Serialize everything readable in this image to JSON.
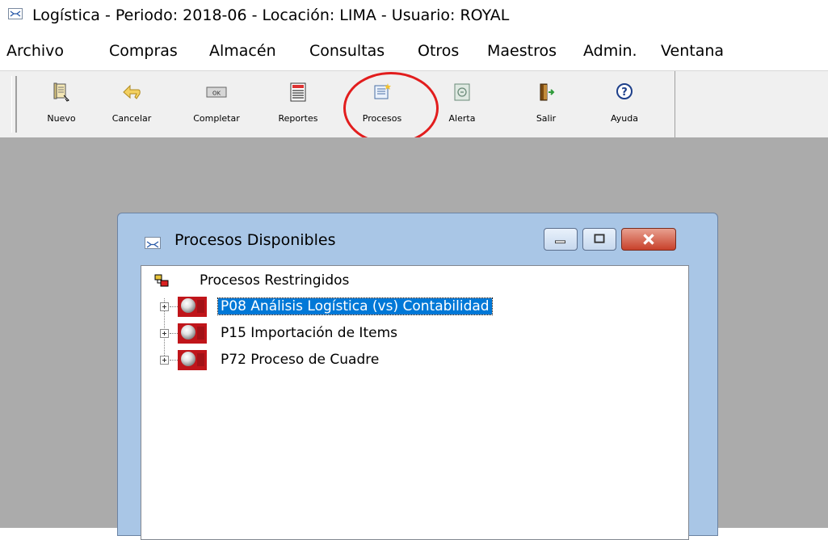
{
  "window": {
    "title": "Logística - Periodo: 2018-06 - Locación: LIMA - Usuario: ROYAL"
  },
  "menu": [
    "Archivo",
    "Compras",
    "Almacén",
    "Consultas",
    "Otros",
    "Maestros",
    "Admin.",
    "Ventana"
  ],
  "toolbar": {
    "buttons": [
      {
        "label": "Nuevo",
        "icon": "new-document-icon"
      },
      {
        "label": "Cancelar",
        "icon": "undo-arrow-icon"
      },
      {
        "label": "Completar",
        "icon": "ok-button-icon"
      },
      {
        "label": "Reportes",
        "icon": "report-icon"
      },
      {
        "label": "Procesos",
        "icon": "process-icon"
      },
      {
        "label": "Alerta",
        "icon": "alert-icon"
      },
      {
        "label": "Salir",
        "icon": "exit-door-icon"
      },
      {
        "label": "Ayuda",
        "icon": "help-icon"
      }
    ],
    "highlighted": "Procesos",
    "highlight_color": "#e21d1d"
  },
  "child_window": {
    "title": "Procesos Disponibles",
    "tree": {
      "root": "Procesos Restringidos",
      "items": [
        {
          "label": "P08 Análisis Logística (vs) Contabilidad",
          "selected": true
        },
        {
          "label": "P15 Importación de Items",
          "selected": false
        },
        {
          "label": "P72 Proceso de Cuadre",
          "selected": false
        }
      ]
    }
  },
  "colors": {
    "workspace": "#ababab",
    "selection": "#0078d7",
    "window_frame": "#a9c6e6",
    "process_icon": "#c0151a"
  }
}
